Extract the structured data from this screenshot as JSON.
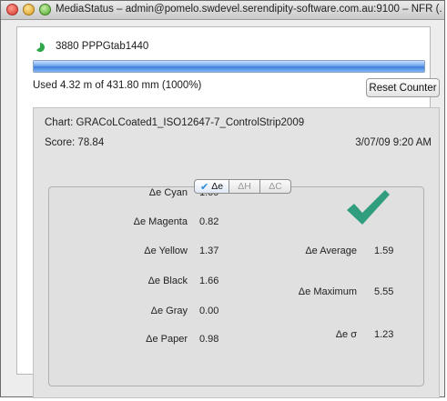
{
  "window": {
    "title": "MediaStatus – admin@pomelo.swdevel.serendipity-software.com.au:9100 – NFR (..."
  },
  "job": {
    "name": "3880 PPPGtab1440",
    "progress_percent": 100,
    "usage_text": "Used 4.32 m of 431.80 mm (1000%)",
    "reset_button": "Reset Counter"
  },
  "report": {
    "chart": "Chart:  GRACoLCoated1_ISO12647-7_ControlStrip2009",
    "score": "Score:  78.84",
    "date": "3/07/09 9:20 AM",
    "tabs": [
      {
        "label": "Δe",
        "active": true
      },
      {
        "label": "ΔH",
        "active": false
      },
      {
        "label": "ΔC",
        "active": false
      }
    ],
    "metrics_left": [
      {
        "label": "Δe Cyan",
        "value": "1.69"
      },
      {
        "label": "Δe Magenta",
        "value": "0.82"
      },
      {
        "label": "Δe Yellow",
        "value": "1.37"
      },
      {
        "label": "Δe Black",
        "value": "1.66"
      },
      {
        "label": "Δe Gray",
        "value": "0.00"
      },
      {
        "label": "Δe Paper",
        "value": "0.98"
      }
    ],
    "metrics_right": [
      {
        "label": "Δe Average",
        "value": "1.59"
      },
      {
        "label": "Δe Maximum",
        "value": "5.55"
      },
      {
        "label": "Δe σ",
        "value": "1.23"
      }
    ],
    "status_icon": "checkmark-icon",
    "status_color": "#2f9d7e"
  },
  "colors": {
    "progress": "#3f7fdc",
    "spinner": "#2ea84a"
  }
}
